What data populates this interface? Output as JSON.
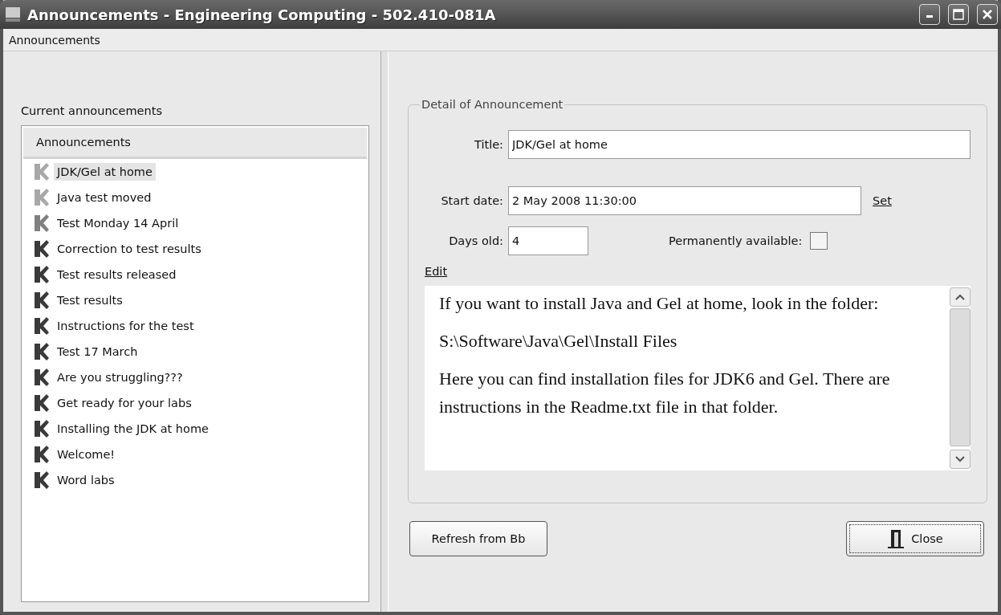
{
  "window": {
    "title": "Announcements - Engineering Computing - 502.410-081A"
  },
  "menu": [
    "Announcements"
  ],
  "list_panel": {
    "label": "Current announcements",
    "column_header": "Announcements",
    "items": [
      {
        "title": "JDK/Gel at home",
        "color": "#a8a8a8",
        "selected": true
      },
      {
        "title": "Java test moved",
        "color": "#a8a8a8",
        "selected": false
      },
      {
        "title": "Test Monday 14 April",
        "color": "#808080",
        "selected": false
      },
      {
        "title": "Correction to test results",
        "color": "#3a3a3a",
        "selected": false
      },
      {
        "title": "Test results released",
        "color": "#3a3a3a",
        "selected": false
      },
      {
        "title": "Test results",
        "color": "#3a3a3a",
        "selected": false
      },
      {
        "title": "Instructions for the test",
        "color": "#3a3a3a",
        "selected": false
      },
      {
        "title": "Test 17 March",
        "color": "#3a3a3a",
        "selected": false
      },
      {
        "title": "Are you struggling???",
        "color": "#3a3a3a",
        "selected": false
      },
      {
        "title": "Get ready for your labs",
        "color": "#3a3a3a",
        "selected": false
      },
      {
        "title": "Installing the JDK at home",
        "color": "#3a3a3a",
        "selected": false
      },
      {
        "title": "Welcome!",
        "color": "#3a3a3a",
        "selected": false
      },
      {
        "title": "Word labs",
        "color": "#3a3a3a",
        "selected": false
      }
    ]
  },
  "detail": {
    "legend": "Detail of Announcement",
    "title_label": "Title:",
    "title_value": "JDK/Gel at home",
    "start_date_label": "Start date:",
    "start_date_value": "2 May 2008 11:30:00",
    "set_link": "Set",
    "days_old_label": "Days old:",
    "days_old_value": "4",
    "permanent_label": "Permanently available:",
    "permanent_checked": false,
    "edit_link": "Edit",
    "body": [
      "If you want to install Java and Gel at home, look in the folder:",
      "S:\\Software\\Java\\Gel\\Install Files",
      "Here you can find installation files for JDK6 and Gel. There are instructions in the Readme.txt file in that folder."
    ]
  },
  "buttons": [
    {
      "label": "Refresh from Bb",
      "kind": "plain"
    },
    {
      "label": "Close",
      "kind": "close"
    }
  ]
}
